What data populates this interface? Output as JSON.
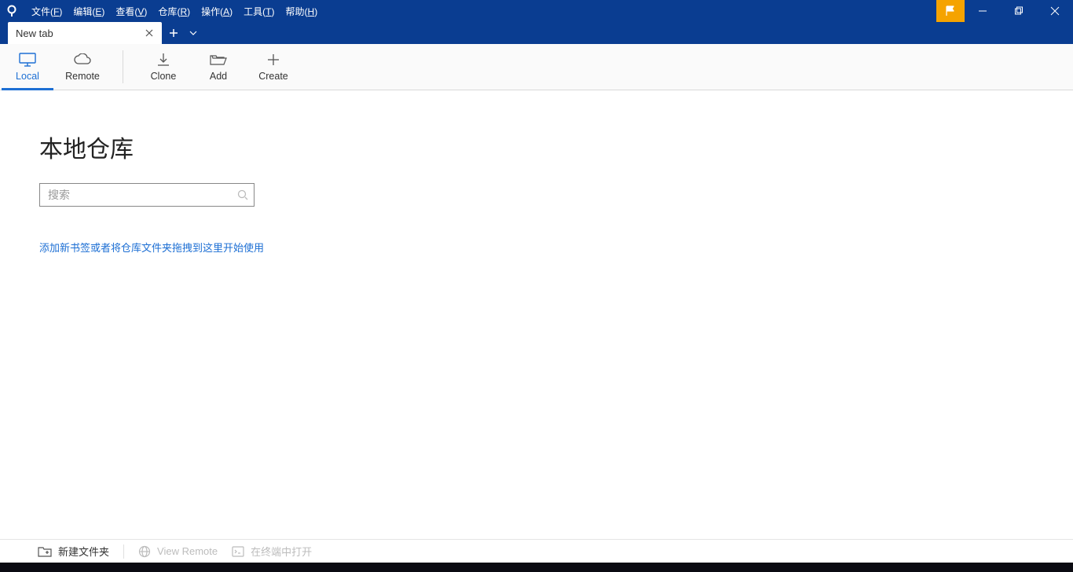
{
  "menubar": {
    "items": [
      {
        "label": "文件",
        "key": "F"
      },
      {
        "label": "编辑",
        "key": "E"
      },
      {
        "label": "查看",
        "key": "V"
      },
      {
        "label": "仓库",
        "key": "R"
      },
      {
        "label": "操作",
        "key": "A"
      },
      {
        "label": "工具",
        "key": "T"
      },
      {
        "label": "帮助",
        "key": "H"
      }
    ]
  },
  "tabstrip": {
    "tabs": [
      {
        "label": "New tab"
      }
    ]
  },
  "toolbar": {
    "local": "Local",
    "remote": "Remote",
    "clone": "Clone",
    "add": "Add",
    "create": "Create"
  },
  "main": {
    "title": "本地仓库",
    "search_placeholder": "搜索",
    "hint": "添加新书签或者将仓库文件夹拖拽到这里开始使用"
  },
  "statusbar": {
    "new_folder": "新建文件夹",
    "view_remote": "View Remote",
    "open_terminal": "在终端中打开"
  }
}
